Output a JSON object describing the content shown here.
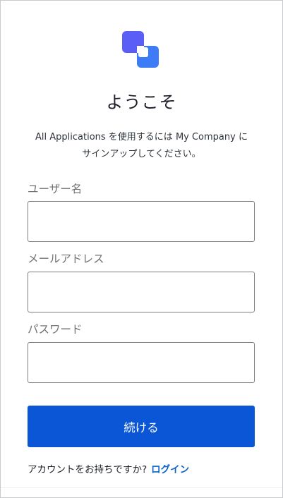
{
  "header": {
    "logo_icon": "brand-logo-icon",
    "title": "ようこそ",
    "subtitle_line1": "All Applications を使用するには My Company に",
    "subtitle_line2": "サインアップしてください。"
  },
  "form": {
    "username": {
      "label": "ユーザー名",
      "value": ""
    },
    "email": {
      "label": "メールアドレス",
      "value": ""
    },
    "password": {
      "label": "パスワード",
      "value": ""
    },
    "continue_label": "続ける"
  },
  "footer": {
    "prompt": "アカウントをお持ちですか?",
    "login_label": "ログイン"
  },
  "colors": {
    "primary": "#0a56d6",
    "link": "#0a62c9",
    "logo_back": "#5b5ef6",
    "logo_front": "#3d7cf6"
  }
}
